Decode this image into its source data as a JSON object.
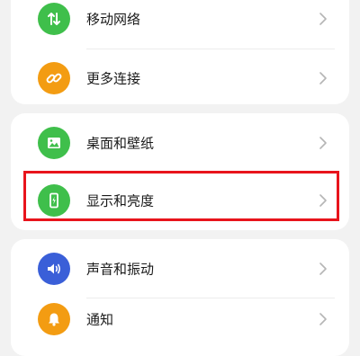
{
  "settings": {
    "items": [
      {
        "label": "移动网络",
        "icon": "mobile-data-icon",
        "color": "#3fbf4b"
      },
      {
        "label": "更多连接",
        "icon": "link-icon",
        "color": "#f39c12"
      },
      {
        "label": "桌面和壁纸",
        "icon": "image-icon",
        "color": "#3fbf4b"
      },
      {
        "label": "显示和亮度",
        "icon": "phone-brightness-icon",
        "color": "#3fbf4b"
      },
      {
        "label": "声音和振动",
        "icon": "speaker-icon",
        "color": "#3a5fd8"
      },
      {
        "label": "通知",
        "icon": "bell-icon",
        "color": "#f39c12"
      }
    ]
  },
  "highlight": {
    "color": "#e8141c",
    "target": "显示和亮度"
  }
}
